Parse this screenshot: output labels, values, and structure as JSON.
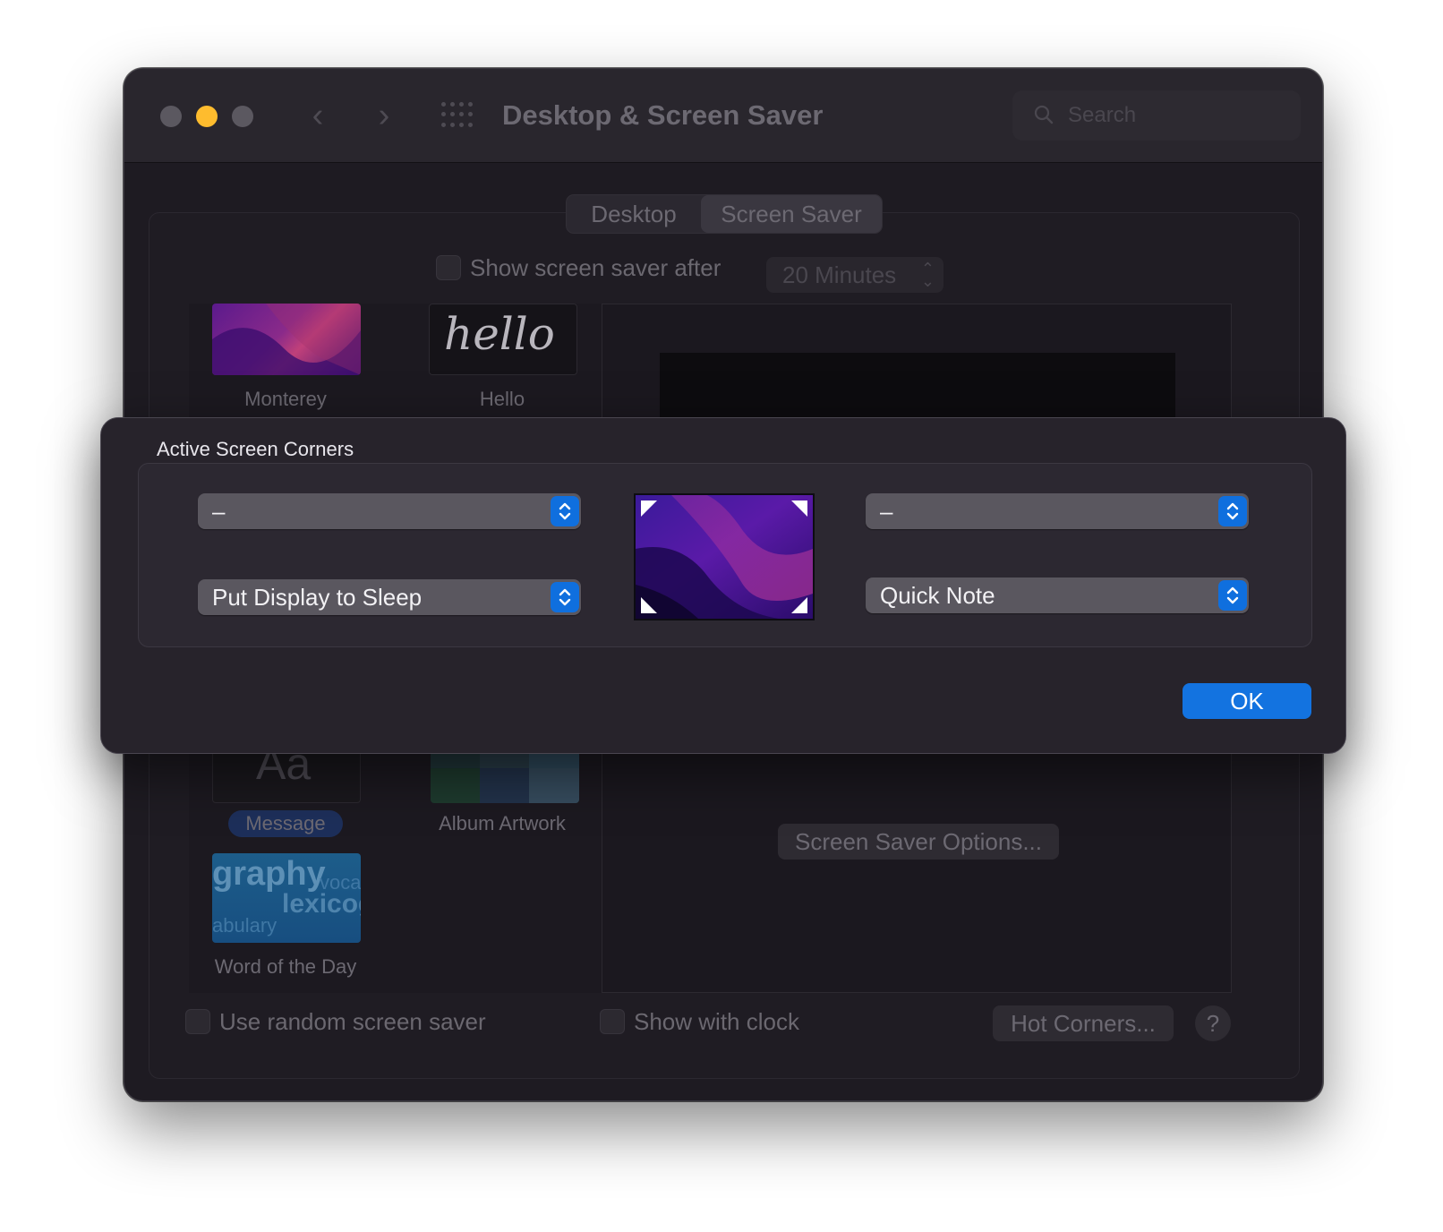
{
  "window": {
    "title": "Desktop & Screen Saver",
    "search_placeholder": "Search"
  },
  "tabs": {
    "desktop": "Desktop",
    "screen_saver": "Screen Saver",
    "selected": "Screen Saver"
  },
  "screen_saver": {
    "show_after_label": "Show screen saver after",
    "show_after_checked": false,
    "show_after_value": "20 Minutes",
    "savers": [
      {
        "label": "Monterey"
      },
      {
        "label": "Hello",
        "thumb_text": "hello"
      },
      {
        "label": "Message",
        "thumb_text": "Aa",
        "selected": true
      },
      {
        "label": "Album Artwork"
      },
      {
        "label": "Word of the Day",
        "thumb_words": [
          "graphy",
          "voca",
          "lexicog",
          "abulary"
        ]
      }
    ],
    "options_button": "Screen Saver Options...",
    "random_label": "Use random screen saver",
    "random_checked": false,
    "clock_label": "Show with clock",
    "clock_checked": false,
    "hot_corners_button": "Hot Corners...",
    "help_button": "?"
  },
  "hot_corners_sheet": {
    "title": "Active Screen Corners",
    "top_left": "–",
    "top_right": "–",
    "bottom_left": "Put Display to Sleep",
    "bottom_right": "Quick Note",
    "ok_button": "OK"
  },
  "colors": {
    "accent": "#1373e0",
    "traffic_minimize": "#febc2e"
  }
}
